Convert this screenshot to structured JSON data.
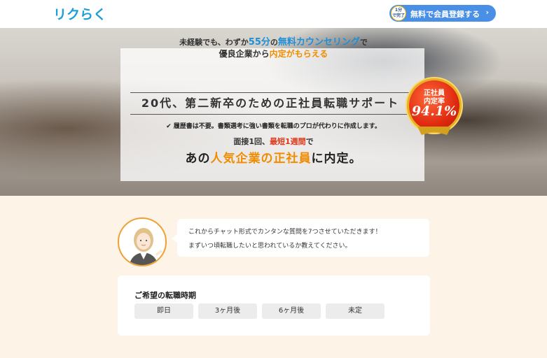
{
  "header": {
    "logo": "リクらく",
    "cta": {
      "badge_top": "1分",
      "badge_bottom": "で完了",
      "label": "無料で会員登録する",
      "chevron": "›"
    }
  },
  "hero": {
    "line1_a": "未経験でも、わずか",
    "line1_b": "55分",
    "line1_c": "の",
    "line1_d": "無料カウンセリング",
    "line1_e": "で",
    "line2_a": "優良企業から",
    "line2_b": "内定がもらえる",
    "headline": "20代、第二新卒のための正社員転職サポート",
    "check": "✔",
    "note": "履歴書は不要。書類選考に強い書類を転職のプロが代わりに作成します。",
    "line4_a": "面接1回、",
    "line4_b": "最短1週間",
    "line4_c": "で",
    "line5_a": "あの",
    "line5_b": "人気企業の正社員",
    "line5_c": "に内定。",
    "seal": {
      "l1": "正社員",
      "l2": "内定率",
      "rate": "94.1%"
    }
  },
  "chat": {
    "message_line1": "これからチャット形式でカンタンな質問を7つさせていただきます！",
    "message_line2": "まずいつ頃転職したいと思われているか教えてください。"
  },
  "question": {
    "title": "ご希望の転職時期",
    "options": [
      "即日",
      "3ヶ月後",
      "6ヶ月後",
      "未定"
    ]
  },
  "colors": {
    "accent_blue": "#4a8fe6",
    "logo_blue": "#1b9fd6",
    "highlight_orange": "#f08c00",
    "highlight_red": "#e03a1a",
    "page_bg": "#fdf3e6"
  }
}
